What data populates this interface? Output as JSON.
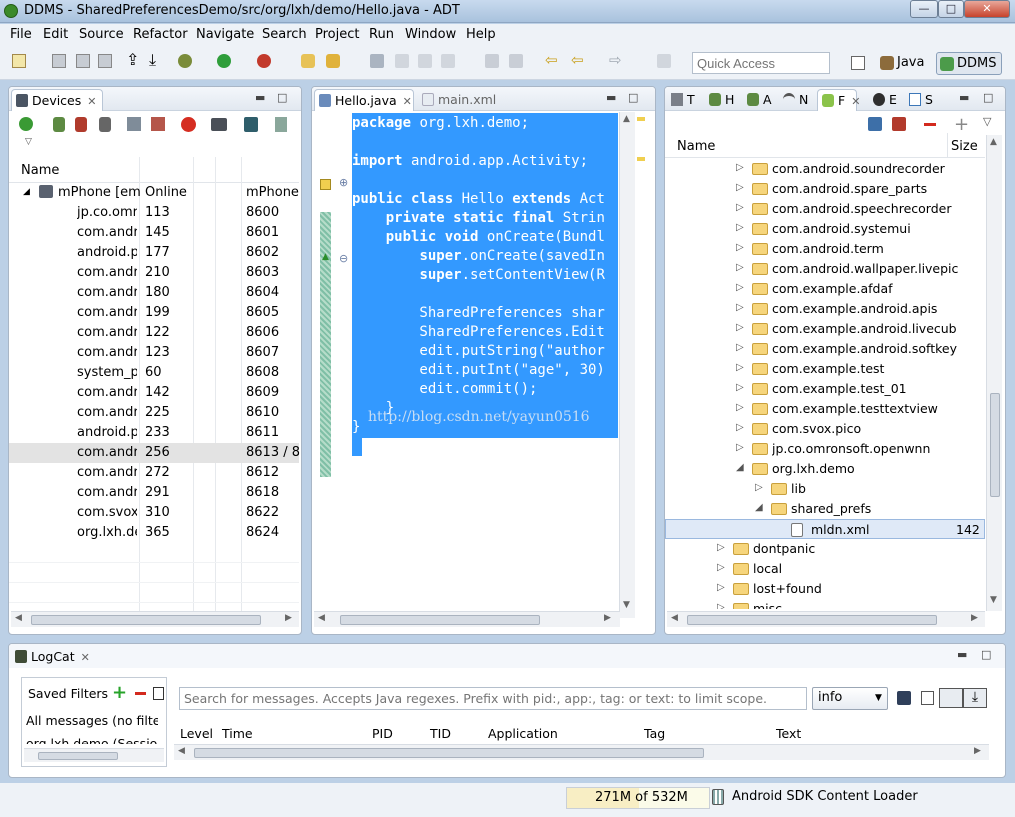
{
  "window": {
    "title": "DDMS - SharedPreferencesDemo/src/org/lxh/demo/Hello.java - ADT",
    "min": "—",
    "max": "□",
    "close": "✕"
  },
  "menu": [
    "File",
    "Edit",
    "Source",
    "Refactor",
    "Navigate",
    "Search",
    "Project",
    "Run",
    "Window",
    "Help"
  ],
  "toolbar": {
    "quick_access_placeholder": "Quick Access",
    "perspectives": [
      "Java",
      "DDMS"
    ]
  },
  "devices": {
    "tab": "Devices",
    "columns": [
      "Name",
      "",
      ""
    ],
    "device": {
      "name": "mPhone [emu",
      "state": "Online",
      "serial": "mPhone"
    },
    "rows": [
      [
        "jp.co.omro",
        "113",
        "8600"
      ],
      [
        "com.andro",
        "145",
        "8601"
      ],
      [
        "android.pr",
        "177",
        "8602"
      ],
      [
        "com.andro",
        "210",
        "8603"
      ],
      [
        "com.andro",
        "180",
        "8604"
      ],
      [
        "com.andro",
        "199",
        "8605"
      ],
      [
        "com.andro",
        "122",
        "8606"
      ],
      [
        "com.andro",
        "123",
        "8607"
      ],
      [
        "system_prc",
        "60",
        "8608"
      ],
      [
        "com.andro",
        "142",
        "8609"
      ],
      [
        "com.andro",
        "225",
        "8610"
      ],
      [
        "android.pr",
        "233",
        "8611"
      ],
      [
        "com.andro",
        "256",
        "8613 / 8"
      ],
      [
        "com.andro",
        "272",
        "8612"
      ],
      [
        "com.andro",
        "291",
        "8618"
      ],
      [
        "com.svox.p",
        "310",
        "8622"
      ],
      [
        "org.lxh.der",
        "365",
        "8624"
      ]
    ]
  },
  "editor": {
    "tabs": [
      "Hello.java",
      "main.xml"
    ],
    "lines": [
      {
        "t": "package org.lxh.demo;",
        "k": [
          "package"
        ]
      },
      {
        "t": "",
        "k": []
      },
      {
        "t": "import android.app.Activity;",
        "k": [
          "import"
        ]
      },
      {
        "t": "",
        "k": []
      },
      {
        "t": "public class Hello extends Act",
        "k": [
          "public",
          "class",
          "extends"
        ]
      },
      {
        "t": "    private static final Strin",
        "k": [
          "private",
          "static",
          "final"
        ]
      },
      {
        "t": "    public void onCreate(Bundl",
        "k": [
          "public",
          "void"
        ]
      },
      {
        "t": "        super.onCreate(savedIn",
        "k": [
          "super"
        ]
      },
      {
        "t": "        super.setContentView(R",
        "k": [
          "super"
        ]
      },
      {
        "t": "",
        "k": []
      },
      {
        "t": "        SharedPreferences shar",
        "k": []
      },
      {
        "t": "        SharedPreferences.Edit",
        "k": []
      },
      {
        "t": "        edit.putString(\"author",
        "k": []
      },
      {
        "t": "        edit.putInt(\"age\", 30)",
        "k": []
      },
      {
        "t": "        edit.commit();",
        "k": []
      },
      {
        "t": "    }",
        "k": []
      },
      {
        "t": "}",
        "k": []
      }
    ],
    "watermark": "http://blog.csdn.net/yayun0516"
  },
  "explorer": {
    "tabs": [
      "T",
      "H",
      "A",
      "N",
      "F",
      "E",
      "S"
    ],
    "columns": [
      "Name",
      "Size"
    ],
    "rows": [
      {
        "name": "com.android.soundrecorder",
        "type": "folder",
        "level": 2,
        "open": false,
        "size": ""
      },
      {
        "name": "com.android.spare_parts",
        "type": "folder",
        "level": 2,
        "open": false,
        "size": ""
      },
      {
        "name": "com.android.speechrecorder",
        "type": "folder",
        "level": 2,
        "open": false,
        "size": ""
      },
      {
        "name": "com.android.systemui",
        "type": "folder",
        "level": 2,
        "open": false,
        "size": ""
      },
      {
        "name": "com.android.term",
        "type": "folder",
        "level": 2,
        "open": false,
        "size": ""
      },
      {
        "name": "com.android.wallpaper.livepic",
        "type": "folder",
        "level": 2,
        "open": false,
        "size": ""
      },
      {
        "name": "com.example.afdaf",
        "type": "folder",
        "level": 2,
        "open": false,
        "size": ""
      },
      {
        "name": "com.example.android.apis",
        "type": "folder",
        "level": 2,
        "open": false,
        "size": ""
      },
      {
        "name": "com.example.android.livecub",
        "type": "folder",
        "level": 2,
        "open": false,
        "size": ""
      },
      {
        "name": "com.example.android.softkey",
        "type": "folder",
        "level": 2,
        "open": false,
        "size": ""
      },
      {
        "name": "com.example.test",
        "type": "folder",
        "level": 2,
        "open": false,
        "size": ""
      },
      {
        "name": "com.example.test_01",
        "type": "folder",
        "level": 2,
        "open": false,
        "size": ""
      },
      {
        "name": "com.example.testtextview",
        "type": "folder",
        "level": 2,
        "open": false,
        "size": ""
      },
      {
        "name": "com.svox.pico",
        "type": "folder",
        "level": 2,
        "open": false,
        "size": ""
      },
      {
        "name": "jp.co.omronsoft.openwnn",
        "type": "folder",
        "level": 2,
        "open": false,
        "size": ""
      },
      {
        "name": "org.lxh.demo",
        "type": "folder",
        "level": 2,
        "open": true,
        "size": ""
      },
      {
        "name": "lib",
        "type": "folder",
        "level": 3,
        "open": false,
        "size": ""
      },
      {
        "name": "shared_prefs",
        "type": "folder",
        "level": 3,
        "open": true,
        "size": ""
      },
      {
        "name": "mldn.xml",
        "type": "file",
        "level": 4,
        "open": false,
        "size": "142"
      },
      {
        "name": "dontpanic",
        "type": "folder",
        "level": 1,
        "open": false,
        "size": ""
      },
      {
        "name": "local",
        "type": "folder",
        "level": 1,
        "open": false,
        "size": ""
      },
      {
        "name": "lost+found",
        "type": "folder",
        "level": 1,
        "open": false,
        "size": ""
      },
      {
        "name": "misc",
        "type": "folder",
        "level": 1,
        "open": false,
        "size": ""
      }
    ]
  },
  "logcat": {
    "tab": "LogCat",
    "saved_filters": "Saved Filters",
    "filters": [
      "All messages (no filte",
      "org.lxh.demo (Sessio"
    ],
    "search_placeholder": "Search for messages. Accepts Java regexes. Prefix with pid:, app:, tag: or text: to limit scope.",
    "level": "info",
    "columns": [
      "Level",
      "Time",
      "PID",
      "TID",
      "Application",
      "Tag",
      "Text"
    ]
  },
  "status": {
    "heap": "271M of 532M",
    "loader": "Android SDK Content Loader"
  },
  "colors": {
    "selection": "#3399ff",
    "folder": "#f6d57c",
    "chrome": "#eef2f7"
  }
}
